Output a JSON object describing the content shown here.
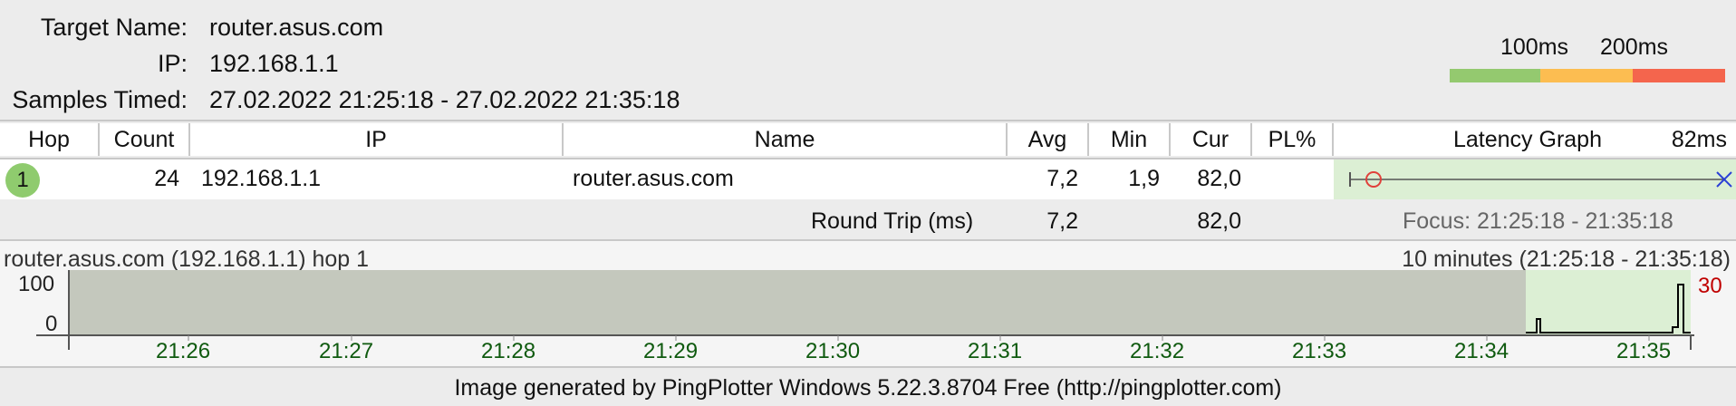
{
  "header": {
    "target_label": "Target Name:",
    "target_value": "router.asus.com",
    "ip_label": "IP:",
    "ip_value": "192.168.1.1",
    "samples_label": "Samples Timed:",
    "samples_value": "27.02.2022 21:25:18 - 27.02.2022 21:35:18"
  },
  "legend": {
    "t1": "100ms",
    "t2": "200ms",
    "colors": [
      "#94c96f",
      "#fcbd51",
      "#f4654d"
    ]
  },
  "table": {
    "headers": {
      "hop": "Hop",
      "count": "Count",
      "ip": "IP",
      "name": "Name",
      "avg": "Avg",
      "min": "Min",
      "cur": "Cur",
      "pl": "PL%",
      "graph": "Latency Graph",
      "graph_max": "82ms"
    },
    "rows": [
      {
        "hop": "1",
        "count": "24",
        "ip": "192.168.1.1",
        "name": "router.asus.com",
        "avg": "7,2",
        "min": "1,9",
        "cur": "82,0",
        "pl": ""
      }
    ],
    "round_trip": {
      "label": "Round Trip (ms)",
      "avg": "7,2",
      "cur": "82,0"
    },
    "focus": "Focus: 21:25:18 - 21:35:18"
  },
  "timeline": {
    "title": "router.asus.com (192.168.1.1) hop 1",
    "range": "10 minutes (21:25:18 - 21:35:18)",
    "y_labels": [
      "100",
      "0"
    ],
    "max_label": "30",
    "x_ticks": [
      "21:26",
      "21:27",
      "21:28",
      "21:29",
      "21:30",
      "21:31",
      "21:32",
      "21:33",
      "21:34",
      "21:35"
    ]
  },
  "footer": "Image generated by PingPlotter Windows 5.22.3.8704 Free (http://pingplotter.com)"
}
